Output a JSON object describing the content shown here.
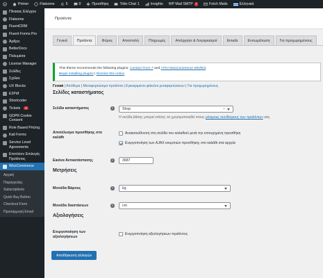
{
  "adminbar": {
    "site": "Primer",
    "theme": "Flatsome",
    "updates": "5",
    "comments": "0",
    "add_new": "Προσθήκη",
    "tidio": "Tidio Chat",
    "tidio_count": "1",
    "insights": "Insights",
    "smtp": "WP Mail SMTP",
    "smtp_badge": "!",
    "fetch": "Fetch Mails",
    "language": "Ελληνικά"
  },
  "sidebar": {
    "items": [
      {
        "label": "Πίνακας Ελέγχου",
        "icon": "dashboard-icon"
      },
      {
        "label": "Flatsome",
        "icon": "flatsome-icon"
      },
      {
        "label": "FluentCRM",
        "icon": "fluentcrm-icon"
      },
      {
        "label": "Fluent Forms Pro",
        "icon": "fluentforms-icon"
      },
      {
        "label": "Άρθρα",
        "icon": "pin-icon"
      },
      {
        "label": "BetterDocs",
        "icon": "docs-icon"
      },
      {
        "label": "Πολυμέσα",
        "icon": "media-icon"
      },
      {
        "label": "License Manager",
        "icon": "key-icon"
      },
      {
        "label": "Σελίδες",
        "icon": "pages-icon"
      },
      {
        "label": "Σχόλια",
        "icon": "comments-icon"
      },
      {
        "label": "UX Blocks",
        "icon": "blocks-icon"
      },
      {
        "label": "E2Pdf",
        "icon": "pdf-icon"
      },
      {
        "label": "Shortcoder",
        "icon": "shortcode-icon"
      },
      {
        "label": "Tickets",
        "icon": "ticket-icon",
        "badge": "1"
      },
      {
        "label": "GDPR Cookie Consent",
        "icon": "cookie-icon"
      },
      {
        "label": "Role Based Pricing",
        "icon": "pricing-icon"
      },
      {
        "label": "Kali Forms",
        "icon": "forms-icon"
      },
      {
        "label": "Service Level Agreements",
        "icon": "sla-icon"
      },
      {
        "label": "Επιπλέον Επιλογές Προϊόντος",
        "icon": "options-icon"
      }
    ],
    "active": {
      "label": "WooCommerce",
      "icon": "woocommerce-icon"
    },
    "submenu": [
      "Αρχική",
      "Παραγγελίες",
      "Subscriptions",
      "Quick Buy Button",
      "Checkout Form",
      "Προσαρμογή Email"
    ]
  },
  "header": {
    "title": "Προϊόντα"
  },
  "tabs": [
    "Γενικά",
    "Προϊόντα",
    "Φόρος",
    "Αποστολή",
    "Πληρωμές",
    "Απόρρητο & Λογαριασμοί",
    "Emails",
    "Ενσωμάτωση",
    "Για προχωρημένους"
  ],
  "active_tab": "Προϊόντα",
  "notice": {
    "prefix": "This theme recommends the following plugins: ",
    "plugin1": "Contact Form 7",
    "and": " and ",
    "plugin2": "YITH WooCommerce Wishlist",
    "suffix": ".",
    "begin_link": "Begin installing plugins",
    "separator": " | ",
    "dismiss_link": "Dismiss this notice"
  },
  "subsections": {
    "current": "Γενικά",
    "others": [
      "Απόθεμα",
      "Μεταφορτώσιμα προϊόντα",
      "Εγκεκριμένοι φάκελοι μεταφορτώσεων",
      "Για προχωρημένους"
    ]
  },
  "shop_pages": {
    "title": "Σελίδες καταστήματος",
    "shop_label": "Σελίδα καταστήματος",
    "shop_value": "Shop",
    "shop_desc_prefix": "Η σελίδα βάσης μπορεί επίσης να χρησιμοποιηθεί στους ",
    "shop_desc_link": "μόνιμους συνδέσμους των προϊόντων",
    "shop_desc_suffix": " σας.",
    "add_to_cart_label": "Αποτέλεσμα προσθήκης στο καλάθι",
    "redirect_label": "Ανακατεύθυνση στη σελίδα του καλαθιού μετά την επιτυχημένη προσθήκη",
    "redirect_checked": false,
    "ajax_label": "Ενεργοποίηση των AJAX κουμπιών προσθήκης στο καλάθι στα αρχεία",
    "ajax_checked": true,
    "placeholder_label": "Εικόνα Αντικατάστασης",
    "placeholder_value": "3687"
  },
  "measurements": {
    "title": "Μετρήσεις",
    "weight_label": "Μονάδα Βάρους",
    "weight_value": "kg",
    "dimensions_label": "Μονάδα διαστάσεων",
    "dimensions_value": "cm"
  },
  "reviews": {
    "title": "Αξιολογήσεις",
    "enable_label": "Ενεργοποίηση των αξιολογήσεων",
    "enable_cb_label": "Ενεργοποίηση αξιολογήσεων προϊόντος",
    "enable_checked": false
  },
  "save_button": "Αποθήκευση αλλαγών"
}
